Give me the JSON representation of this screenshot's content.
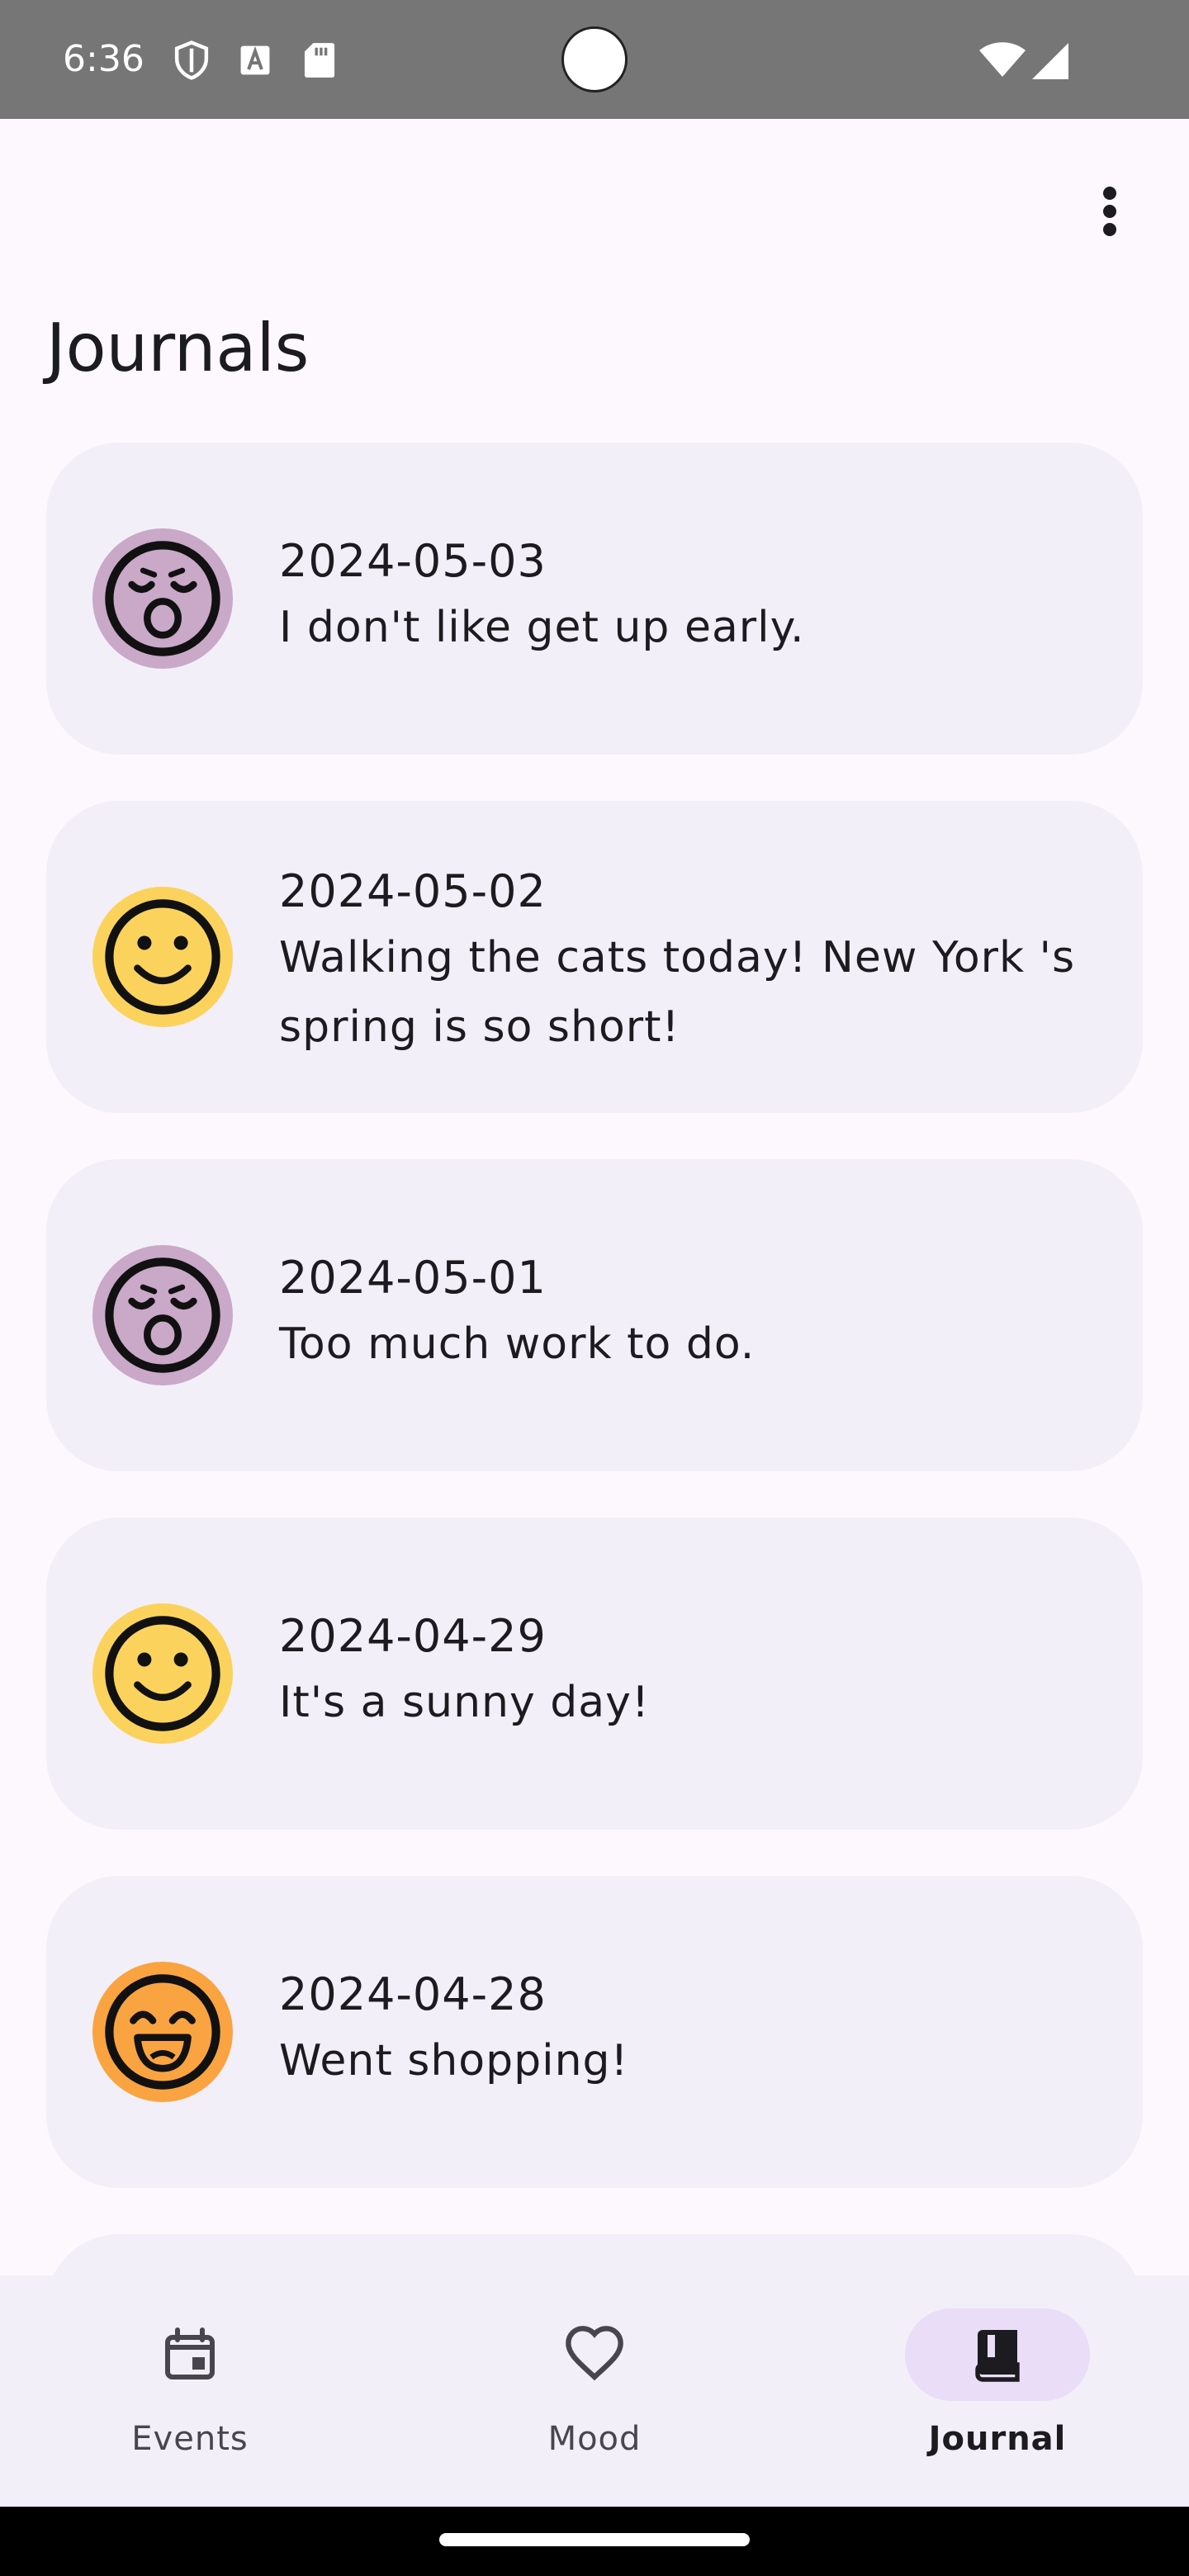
{
  "status_bar": {
    "time": "6:36",
    "icons": [
      "shield-icon",
      "text-a-icon",
      "sd-card-icon",
      "wifi-icon",
      "signal-icon"
    ]
  },
  "top_bar": {
    "menu_icon": "more-vert-icon"
  },
  "page": {
    "title": "Journals"
  },
  "journals": [
    {
      "date": "2024-05-03",
      "note": "I don't like get up early.",
      "mood": "tired-face-icon",
      "mood_color": "#c9a8c8"
    },
    {
      "date": "2024-05-02",
      "note": "Walking the cats today! New York 's spring is so short!",
      "mood": "smile-face-icon",
      "mood_color": "#fbd35c"
    },
    {
      "date": "2024-05-01",
      "note": "Too much work to do.",
      "mood": "tired-face-icon",
      "mood_color": "#c9a8c8"
    },
    {
      "date": "2024-04-29",
      "note": "It's a sunny day!",
      "mood": "smile-face-icon",
      "mood_color": "#fbd35c"
    },
    {
      "date": "2024-04-28",
      "note": "Went shopping!",
      "mood": "laughing-face-icon",
      "mood_color": "#f9a440"
    }
  ],
  "bottom_nav": {
    "items": [
      {
        "label": "Events",
        "icon": "calendar-icon",
        "active": false
      },
      {
        "label": "Mood",
        "icon": "heart-icon",
        "active": false
      },
      {
        "label": "Journal",
        "icon": "book-icon",
        "active": true
      }
    ]
  },
  "colors": {
    "background": "#fdf8fd",
    "card": "#f2eff9",
    "status_bar": "#767676",
    "nav_active_pill": "#e9ddf7"
  }
}
